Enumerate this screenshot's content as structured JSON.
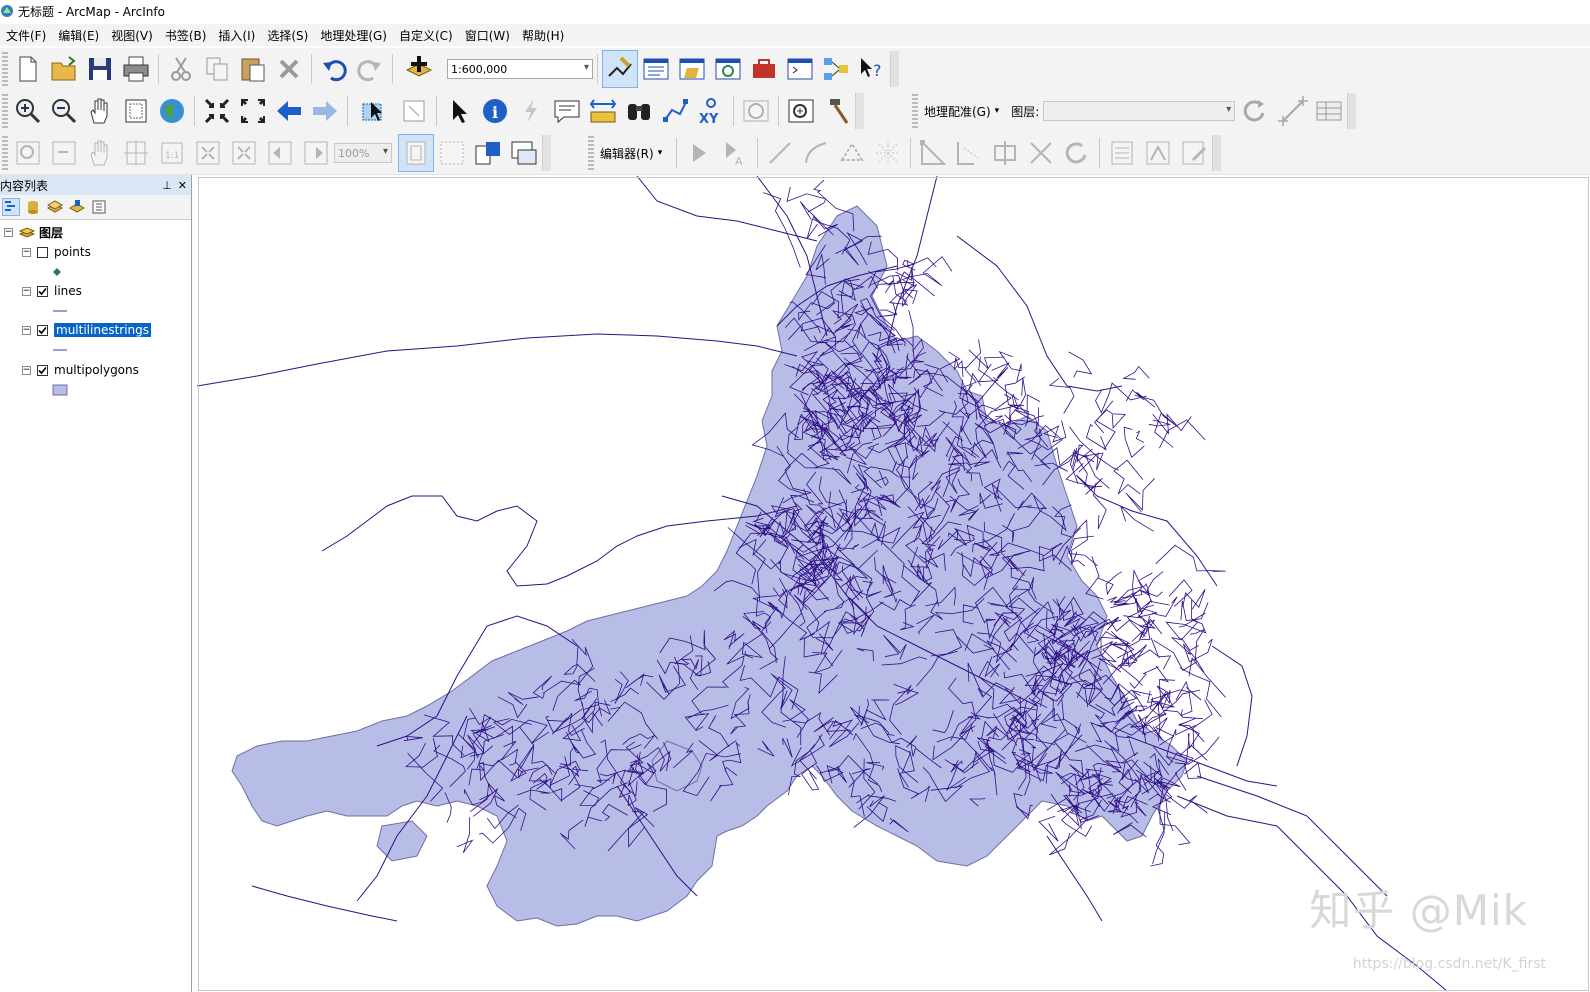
{
  "window": {
    "title": "无标题 - ArcMap - ArcInfo"
  },
  "menu": [
    "文件(F)",
    "编辑(E)",
    "视图(V)",
    "书签(B)",
    "插入(I)",
    "选择(S)",
    "地理处理(G)",
    "自定义(C)",
    "窗口(W)",
    "帮助(H)"
  ],
  "toolbar": {
    "scale": "1:600,000",
    "zoom_percent": "100%",
    "editor_label": "编辑器(R)",
    "georef_label": "地理配准(G)",
    "layer_label": "图层:"
  },
  "toc": {
    "title": "内容列表",
    "root": "图层",
    "layers": [
      {
        "name": "points",
        "checked": false,
        "selected": false,
        "symbol": "point"
      },
      {
        "name": "lines",
        "checked": true,
        "selected": false,
        "symbol": "line"
      },
      {
        "name": "multilinestrings",
        "checked": true,
        "selected": true,
        "symbol": "line"
      },
      {
        "name": "multipolygons",
        "checked": true,
        "selected": false,
        "symbol": "polygon"
      }
    ]
  },
  "map": {
    "polygon_fill": "#b8bde8",
    "polygon_stroke": "#6d6fa6",
    "line_color": "#2f0f86"
  },
  "watermark": {
    "text": "知乎 @Mik",
    "url": "https://blog.csdn.net/K_first"
  },
  "colors": {
    "accent_select": "#0a64c8",
    "toc_header": "#dbe6f4"
  }
}
